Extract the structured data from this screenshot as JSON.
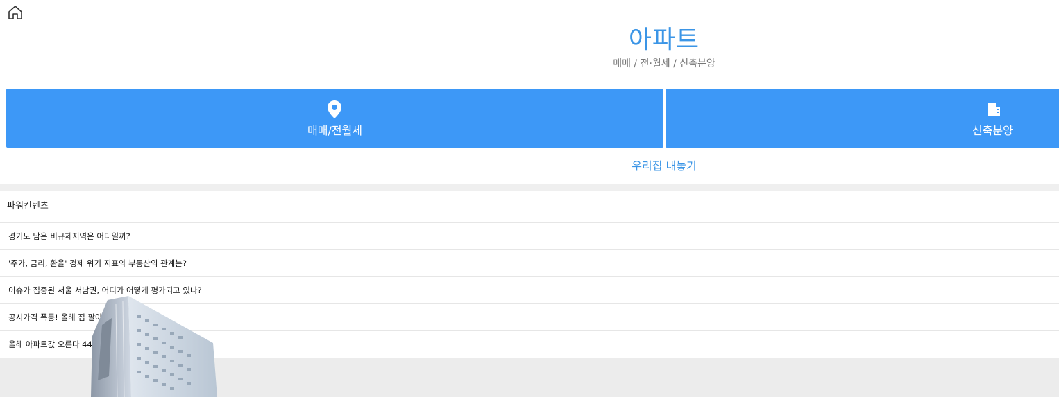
{
  "header": {
    "title": "아파트",
    "subtitle": "매매 / 전·월세 / 신축분양"
  },
  "categories": [
    {
      "label": "매매/전월세",
      "icon": "location-pin-icon"
    },
    {
      "label": "신축분양",
      "icon": "building-icon"
    }
  ],
  "list_house_label": "우리집 내놓기",
  "power_contents": {
    "title": "파워컨텐츠",
    "items": [
      "경기도 남은 비규제지역은 어디일까?",
      "'주가, 금리, 환율' 경제 위기 지표와 부동산의 관계는?",
      "이슈가 집중된 서울 서남권, 어디가 어떻게 평가되고 있나?",
      "공시가격 폭등! 올해 집 팔아",
      "올해 아파트값 오른다 44"
    ]
  },
  "colors": {
    "accent": "#3d98f7",
    "title": "#3b95e6",
    "divider": "#e6e6e6",
    "footer_bg": "#ececec"
  }
}
